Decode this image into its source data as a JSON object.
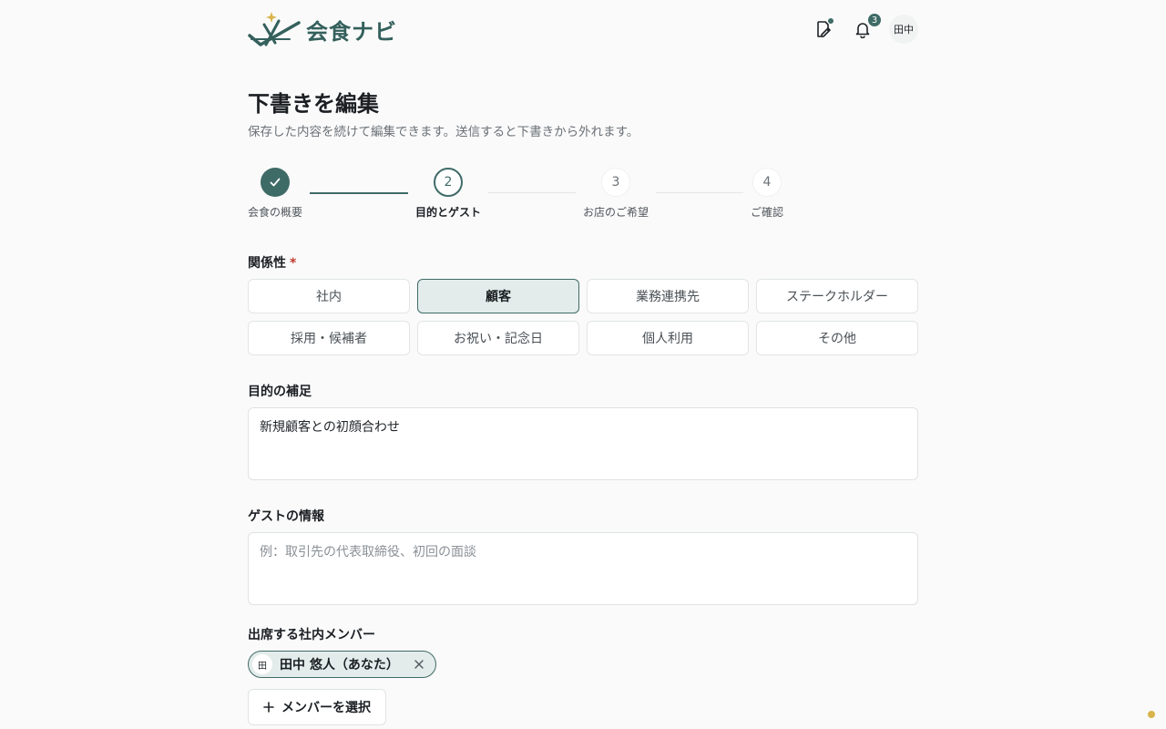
{
  "app": {
    "name": "会食ナビ"
  },
  "header": {
    "user_initials": "田中",
    "notification_count": "3",
    "icons": {
      "drafts": "draft-edit-icon",
      "notifications": "bell-icon"
    }
  },
  "page": {
    "title": "下書きを編集",
    "subtitle": "保存した内容を続けて編集できます。送信すると下書きから外れます。"
  },
  "steps": [
    {
      "number": "1",
      "label": "会食の概要",
      "state": "done"
    },
    {
      "number": "2",
      "label": "目的とゲスト",
      "state": "active"
    },
    {
      "number": "3",
      "label": "お店のご希望",
      "state": "todo"
    },
    {
      "number": "4",
      "label": "ご確認",
      "state": "todo"
    }
  ],
  "relationship": {
    "label": "関係性",
    "required_mark": "*",
    "options": [
      {
        "label": "社内",
        "selected": false
      },
      {
        "label": "顧客",
        "selected": true
      },
      {
        "label": "業務連携先",
        "selected": false
      },
      {
        "label": "ステークホルダー",
        "selected": false
      },
      {
        "label": "採用・候補者",
        "selected": false
      },
      {
        "label": "お祝い・記念日",
        "selected": false
      },
      {
        "label": "個人利用",
        "selected": false
      },
      {
        "label": "その他",
        "selected": false
      }
    ]
  },
  "purpose": {
    "label": "目的の補足",
    "value": "新規顧客との初顔合わせ",
    "placeholder": ""
  },
  "guest": {
    "label": "ゲストの情報",
    "value": "",
    "placeholder": "例：取引先の代表取締役、初回の面談"
  },
  "members": {
    "label": "出席する社内メンバー",
    "chips": [
      {
        "initial": "田",
        "name": "田中 悠人（あなた）"
      }
    ],
    "select_button": "メンバーを選択"
  },
  "colors": {
    "brand": "#3f6b67",
    "brand_light": "#e3ecea",
    "required": "#c0392b",
    "accent_gold": "#d9b44a"
  }
}
